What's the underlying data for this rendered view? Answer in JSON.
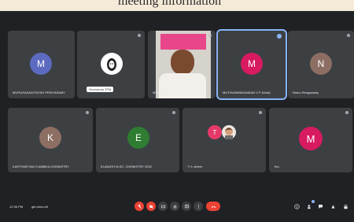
{
  "document": {
    "title": "meeting information"
  },
  "tiles": [
    {
      "name": "MURUGASANTHOSH PERIYASAMY",
      "initial": "M",
      "color": "#5c6bc0"
    },
    {
      "name": "Sivananda TPM",
      "initial": "",
      "color": ""
    },
    {
      "name": "MOHAN",
      "initial": "",
      "color": ""
    },
    {
      "name": "MUTHUMANIKANDAN V P (Host)",
      "initial": "M",
      "color": "#d81b60"
    },
    {
      "name": "Ramu Rengasamy",
      "initial": "N",
      "color": "#8d6e63"
    },
    {
      "name": "KARTHIKEYAN S AMBIKA CHEMISTRY",
      "initial": "K",
      "color": "#8d6e63"
    },
    {
      "name": "ELANATH M.SC. CHEMISTRY 2022",
      "initial": "E",
      "color": "#2e7d32"
    },
    {
      "name": "T+1 others",
      "initial": "T",
      "color": "#e53969"
    },
    {
      "name": "You",
      "initial": "M",
      "color": "#d81b60"
    }
  ],
  "bottom": {
    "time": "12:36 PM",
    "meeting_code": "gkt-xbnz-idf"
  },
  "colors": {
    "meet_bg": "#202124",
    "tile_bg": "#3c4043",
    "danger": "#ea4335",
    "accent": "#8ab4f8"
  },
  "controls": [
    "mic-off-icon",
    "camera-off-icon",
    "captions-icon",
    "raise-hand-icon",
    "present-icon",
    "more-options-icon",
    "hangup-icon"
  ],
  "right_icons": [
    "info-icon",
    "people-icon",
    "chat-icon",
    "activities-icon",
    "lock-icon"
  ]
}
